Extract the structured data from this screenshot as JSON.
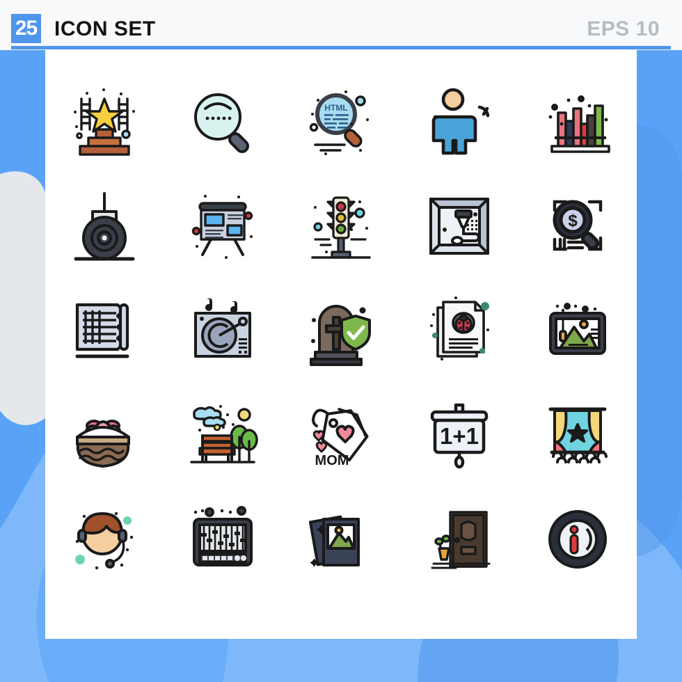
{
  "header": {
    "badge_count": "25",
    "title": "ICON SET",
    "eps_label": "EPS 10",
    "accent_color": "#4f95ec",
    "title_color": "#141414",
    "eps_color": "#b8bcc0"
  },
  "page": {
    "background_color": "#5aa2f7",
    "card_color": "#ffffff",
    "blob_light_color": "#7fb8fa",
    "blob_grey_color": "#e4e8ea"
  },
  "grid": {
    "columns": 5,
    "rows": 5,
    "total_icons": 25
  },
  "icons": [
    {
      "index": 1,
      "name": "award-podium-icon",
      "label": "Award podium with star and ladders",
      "colors": [
        "#b3603a",
        "#d4823f",
        "#f7cf3f",
        "#a8dcf0"
      ]
    },
    {
      "index": 2,
      "name": "search-magnifier-icon",
      "label": "Magnifying glass with dots",
      "colors": [
        "#d8f2f0",
        "#5c6273",
        "#1a1a1a"
      ]
    },
    {
      "index": 3,
      "name": "html-code-search-icon",
      "label": "HTML code magnifier",
      "colors": [
        "#a8dcf0",
        "#3a3f4a",
        "#b3603a"
      ],
      "text": "HTML"
    },
    {
      "index": 4,
      "name": "user-performance-icon",
      "label": "Person with speedometer gauge",
      "colors": [
        "#4aa3d8",
        "#f5cfa0",
        "#1a1a1a"
      ]
    },
    {
      "index": 5,
      "name": "books-shelf-chart-icon",
      "label": "Books on shelf",
      "colors": [
        "#e8737f",
        "#2d3b55",
        "#e03a3a",
        "#4a4040",
        "#7fb84a"
      ]
    },
    {
      "index": 6,
      "name": "wheel-roller-icon",
      "label": "Wheel roller machine",
      "colors": [
        "#3a3f4a",
        "#e4e8ea",
        "#1a1a1a"
      ]
    },
    {
      "index": 7,
      "name": "presentation-board-icon",
      "label": "Presentation board",
      "colors": [
        "#4f95ec",
        "#c9d2e0",
        "#3a3f4a",
        "#d63a3a"
      ]
    },
    {
      "index": 8,
      "name": "traffic-light-icon",
      "label": "Traffic light",
      "colors": [
        "#c83a4a",
        "#e0c03a",
        "#6aa83a",
        "#f2ead8",
        "#6fd4e0"
      ]
    },
    {
      "index": 9,
      "name": "engraving-machine-icon",
      "label": "Engraving / 3D printer frame",
      "colors": [
        "#c9d2e0",
        "#3a3f4a",
        "#eef1f5"
      ]
    },
    {
      "index": 10,
      "name": "money-search-icon",
      "label": "Dollar magnifier over document",
      "colors": [
        "#2a2f3a",
        "#c9d2e8",
        "#ffffff"
      ],
      "text": "$"
    },
    {
      "index": 11,
      "name": "blueprint-plan-icon",
      "label": "Blueprint scroll plan",
      "colors": [
        "#d4dae8",
        "#1a1a1a"
      ]
    },
    {
      "index": 12,
      "name": "turntable-record-icon",
      "label": "Turntable record player",
      "colors": [
        "#c9d2e0",
        "#9aa5bd",
        "#1a1a1a"
      ]
    },
    {
      "index": 13,
      "name": "life-insurance-grave-icon",
      "label": "Tombstone with shield check",
      "colors": [
        "#7a6a5e",
        "#56505c",
        "#7fb84a",
        "#ffffff"
      ]
    },
    {
      "index": 14,
      "name": "bug-report-document-icon",
      "label": "Bug report document",
      "colors": [
        "#eef1f5",
        "#d63a4a",
        "#3d8a6a"
      ]
    },
    {
      "index": 15,
      "name": "image-editor-tablet-icon",
      "label": "Picture tablet with mountains",
      "colors": [
        "#3a3f4a",
        "#7fa84a",
        "#e8a64a",
        "#ffffff"
      ]
    },
    {
      "index": 16,
      "name": "easter-basket-icon",
      "label": "Easter basket with eggs",
      "colors": [
        "#8a6a52",
        "#c9a882",
        "#f2a0b0",
        "#8fd4a8",
        "#a8dcf0",
        "#e8737f"
      ]
    },
    {
      "index": 17,
      "name": "park-bench-trees-icon",
      "label": "Park bench with trees",
      "colors": [
        "#c4622e",
        "#6aba4a",
        "#a8dcf0",
        "#f2d87a"
      ]
    },
    {
      "index": 18,
      "name": "mom-gift-tags-icon",
      "label": "MOM gift tags with hearts",
      "colors": [
        "#ffffff",
        "#f08a9a",
        "#1a1a1a"
      ],
      "text": "MOM"
    },
    {
      "index": 19,
      "name": "math-projector-icon",
      "label": "Projector screen showing 1+1",
      "colors": [
        "#eef1f8",
        "#1a1a1a"
      ],
      "text": "1+1"
    },
    {
      "index": 20,
      "name": "theater-stage-icon",
      "label": "Theater stage with curtains",
      "colors": [
        "#6fd4e0",
        "#f2d87a",
        "#f2737f",
        "#1a1a1a"
      ]
    },
    {
      "index": 21,
      "name": "support-headset-icon",
      "label": "Support agent with headset",
      "colors": [
        "#f5cfa0",
        "#a0522d",
        "#56606f",
        "#6ed4b0"
      ]
    },
    {
      "index": 22,
      "name": "audio-mixer-icon",
      "label": "Audio mixer equalizer",
      "colors": [
        "#3a3f4a",
        "#e4e8ea",
        "#1a1a1a"
      ]
    },
    {
      "index": 23,
      "name": "photo-gallery-icon",
      "label": "Photo gallery stack",
      "colors": [
        "#3a4257",
        "#7fa84a",
        "#ffffff"
      ]
    },
    {
      "index": 24,
      "name": "door-plant-icon",
      "label": "Door with potted plant",
      "colors": [
        "#4a3a30",
        "#6a5244",
        "#e8a63a",
        "#6aba4a"
      ]
    },
    {
      "index": 25,
      "name": "info-circle-icon",
      "label": "Information circle",
      "colors": [
        "#2a2f3a",
        "#eef1f5",
        "#e03a3a"
      ],
      "text": "i"
    }
  ]
}
